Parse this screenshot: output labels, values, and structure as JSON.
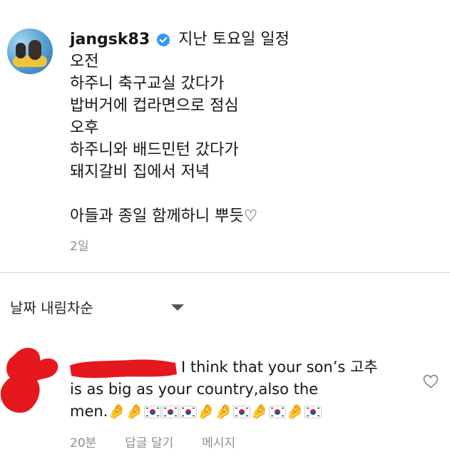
{
  "post": {
    "username": "jangsk83",
    "title": "지난 토요일 일정",
    "lines": [
      "오전",
      "하주니 축구교실 갔다가",
      "밥버거에 컵라면으로 점심",
      "오후",
      "하주니와 배드민턴 갔다가",
      "돼지갈비 집에서 저녁",
      "",
      "아들과 종일 함께하니 뿌듯♡"
    ],
    "time": "2일"
  },
  "sort": {
    "label": "날짜 내림차순",
    "icon": "caret-down-icon"
  },
  "comment": {
    "line1": "I think that your son’s 고추",
    "line2": "is as big as your country,also the",
    "line3": "men.",
    "emoji_sequence": [
      "pinch",
      "pinch",
      "flag-kr",
      "flag-kr",
      "flag-kr",
      "pinch",
      "pinch",
      "flag-kr",
      "pinch",
      "flag-kr",
      "pinch",
      "flag-kr"
    ],
    "time": "20분",
    "reply_label": "답글 달기",
    "message_label": "메시지"
  },
  "colors": {
    "verified": "#3897f0",
    "secondary_text": "#8e8e8e",
    "redaction": "#e5191d",
    "divider": "#dbdbdb"
  }
}
